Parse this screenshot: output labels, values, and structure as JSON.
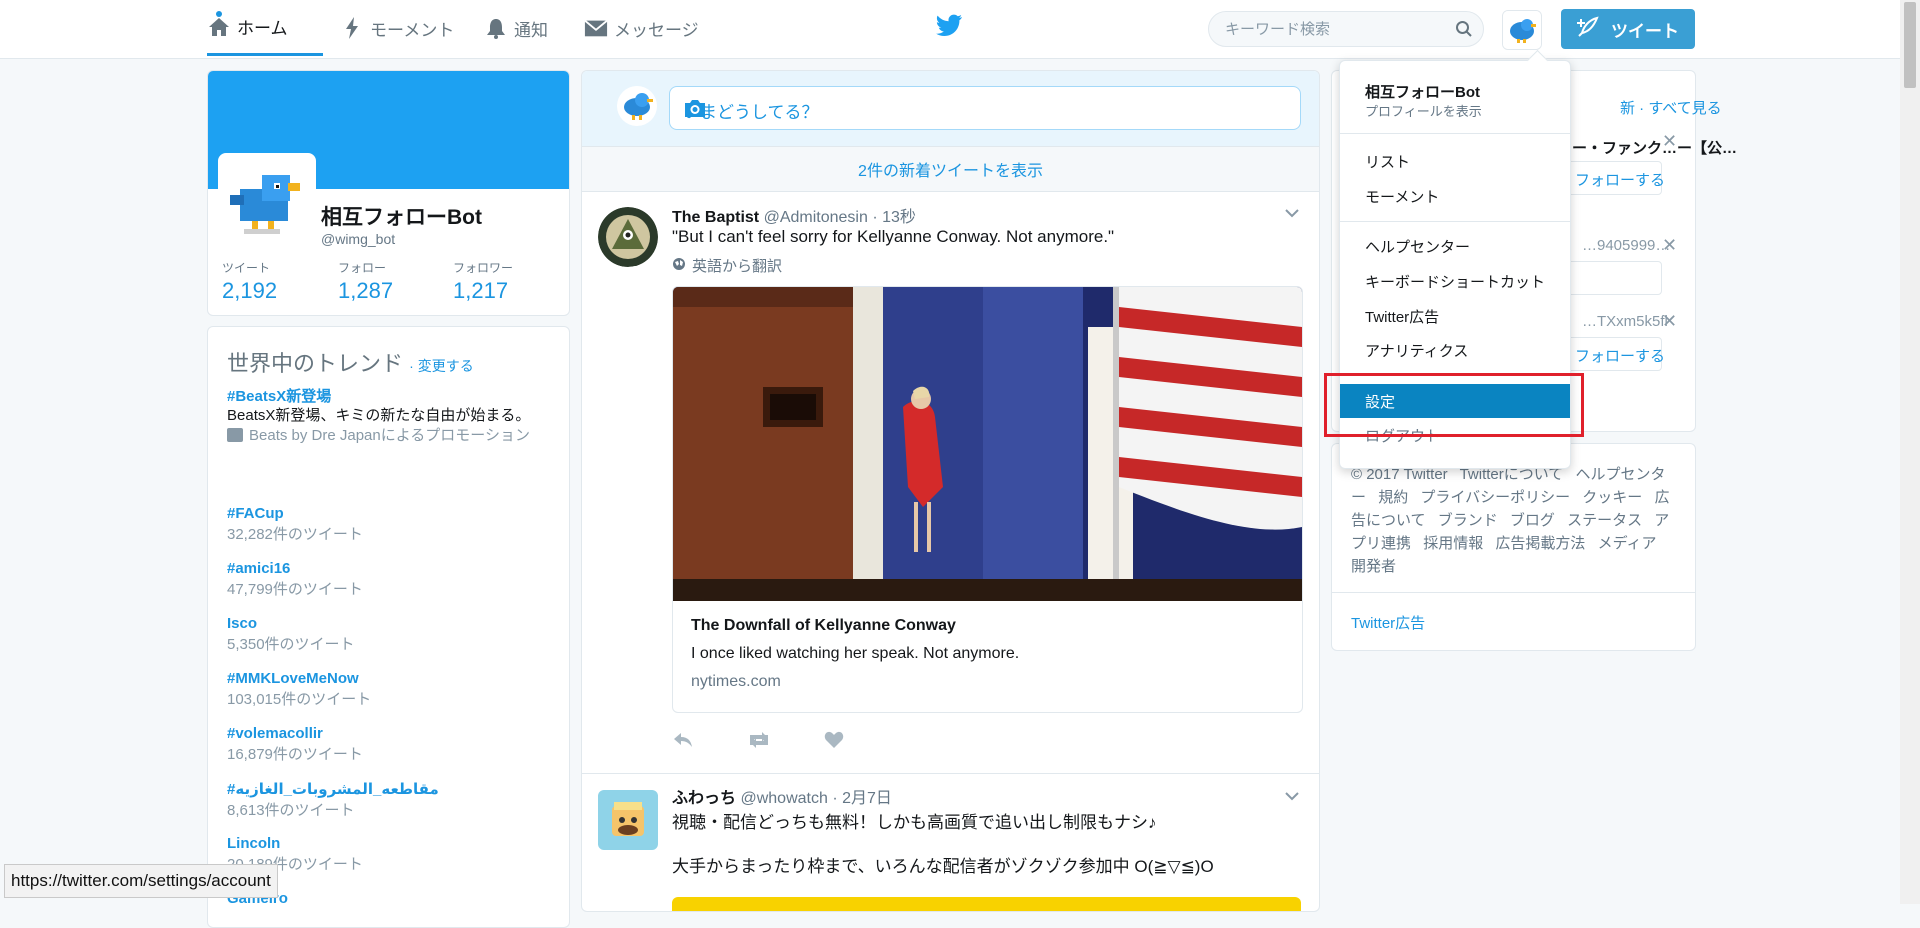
{
  "nav": {
    "home": "ホーム",
    "moments": "モーメント",
    "notifications": "通知",
    "messages": "メッセージ",
    "tweet_button": "ツイート"
  },
  "search": {
    "placeholder": "キーワード検索"
  },
  "profile": {
    "name": "相互フォローBot",
    "handle": "@wimg_bot",
    "stats": [
      {
        "label": "ツイート",
        "value": "2,192"
      },
      {
        "label": "フォロー",
        "value": "1,287"
      },
      {
        "label": "フォロワー",
        "value": "1,217"
      }
    ]
  },
  "trends": {
    "title": "世界中のトレンド",
    "change": "· 変更する",
    "items": [
      {
        "name": "#BeatsX新登場",
        "desc": "BeatsX新登場、キミの新たな自由が始まる。",
        "promo": "Beats by Dre Japanによるプロモーション"
      },
      {
        "name": "#FACup",
        "count": "32,282件のツイート"
      },
      {
        "name": "#amici16",
        "count": "47,799件のツイート"
      },
      {
        "name": "Isco",
        "count": "5,350件のツイート"
      },
      {
        "name": "#MMKLoveMeNow",
        "count": "103,015件のツイート"
      },
      {
        "name": "#volemacollir",
        "count": "16,879件のツイート"
      },
      {
        "name": "#مقاطعه_المشروبات_الغازيه",
        "count": "8,613件のツイート"
      },
      {
        "name": "Lincoln",
        "count": "20,189件のツイート"
      },
      {
        "name": "Gameiro",
        "count": ""
      }
    ]
  },
  "compose": {
    "placeholder": "いまどうしてる？"
  },
  "new_tweets": "2件の新着ツイートを表示",
  "tweets": [
    {
      "name": "The Baptist",
      "handle": "@Admitonesin",
      "time": "· 13秒",
      "text": "\"But I can't feel sorry for Kellyanne Conway. Not anymore.\"",
      "translate": "英語から翻訳",
      "card_title": "The Downfall of Kellyanne Conway",
      "card_desc": "I once liked watching her speak. Not anymore.",
      "card_url": "nytimes.com"
    },
    {
      "name": "ふわっち",
      "handle": "@whowatch",
      "time": "· 2月7日",
      "text1": "視聴・配信どっちも無料！しかも高画質で追い出し制限もナシ♪",
      "text2": "大手からまったり枠まで、いろんな配信者がゾクゾク参加中 O(≧▽≦)O"
    }
  ],
  "right_panel": {
    "header": "新 · すべて見る",
    "items": [
      "ー・ファンク…ー【公…",
      "フォローする",
      "…9405999…",
      "…TXxm5k5fl",
      "フォローする"
    ],
    "footer": [
      "© 2017 Twitter",
      "Twitterについて",
      "ヘルプセンター",
      "規約",
      "プライバシーポリシー",
      "クッキー",
      "広告について",
      "ブランド",
      "ブログ",
      "ステータス",
      "アプリ連携",
      "採用情報",
      "広告掲載方法",
      "メディア",
      "開発者"
    ],
    "ads": "Twitter広告"
  },
  "dropdown": {
    "name": "相互フォローBot",
    "view_profile": "プロフィールを表示",
    "lists": "リスト",
    "moments": "モーメント",
    "help": "ヘルプセンター",
    "shortcuts": "キーボードショートカット",
    "ads": "Twitter広告",
    "analytics": "アナリティクス",
    "settings": "設定",
    "logout": "ログアウト"
  },
  "status_url": "https://twitter.com/settings/account",
  "colors": {
    "accent": "#1b95e0",
    "banner": "#1da1f2",
    "selected": "#0a84c1",
    "highlight": "#e0202b"
  }
}
